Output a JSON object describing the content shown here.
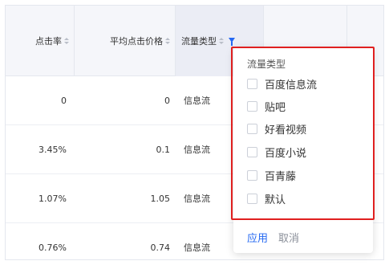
{
  "columns": {
    "ctr": "点击率",
    "avg_cpc": "平均点击价格",
    "traffic_type": "流量类型"
  },
  "rows": [
    {
      "ctr": "0",
      "avg_cpc": "0",
      "traffic_type": "信息流"
    },
    {
      "ctr": "3.45%",
      "avg_cpc": "0.1",
      "traffic_type": "信息流"
    },
    {
      "ctr": "1.07%",
      "avg_cpc": "1.05",
      "traffic_type": "信息流"
    },
    {
      "ctr": "0.76%",
      "avg_cpc": "0.74",
      "traffic_type": "信息流"
    }
  ],
  "filter": {
    "title": "流量类型",
    "options": [
      "百度信息流",
      "贴吧",
      "好看视频",
      "百度小说",
      "百青藤",
      "默认"
    ],
    "apply_label": "应用",
    "cancel_label": "取消"
  },
  "colors": {
    "accent": "#2468f2",
    "highlight": "#e02020",
    "header_bg": "#f5f6fa"
  }
}
